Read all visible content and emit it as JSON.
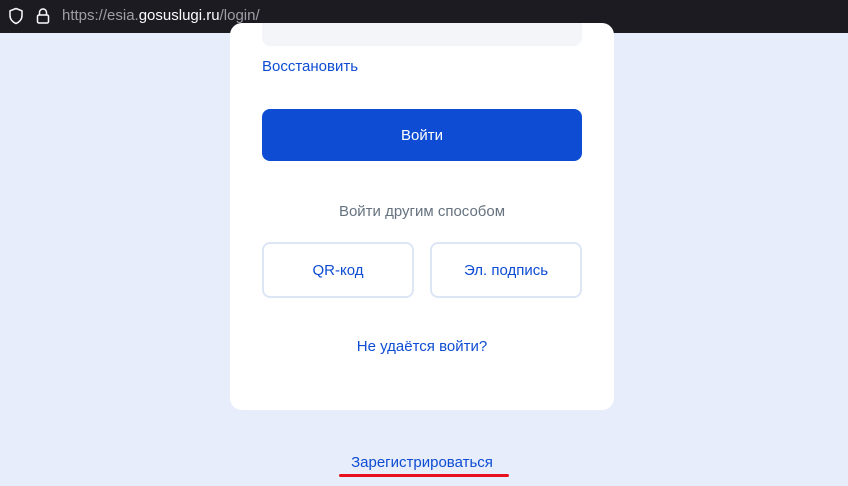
{
  "browser": {
    "url_prefix": "https://esia.",
    "url_domain": "gosuslugi.ru",
    "url_path": "/login/",
    "icons": [
      "shield-icon",
      "lock-icon"
    ]
  },
  "login": {
    "restore_label": "Восстановить",
    "submit_label": "Войти",
    "alt_methods_label": "Войти другим способом",
    "qr_label": "QR-код",
    "signature_label": "Эл. подпись",
    "trouble_label": "Не удаётся войти?"
  },
  "footer": {
    "register_label": "Зарегистрироваться"
  },
  "colors": {
    "accent": "#0d4cd3",
    "background": "#e7edfb",
    "annotation_underline": "#e8101d"
  }
}
